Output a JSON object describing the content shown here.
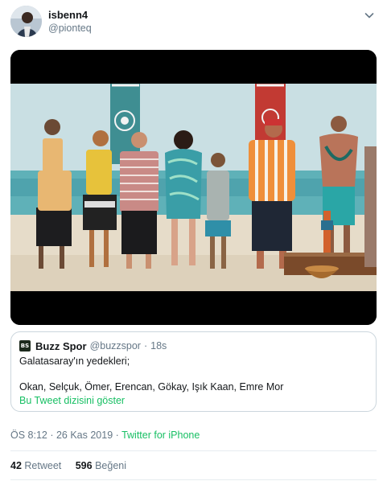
{
  "author": {
    "name": "isbenn4",
    "handle": "@pionteq"
  },
  "media": {
    "icon": "photo"
  },
  "quoted": {
    "avatar_text": "BS",
    "name": "Buzz Spor",
    "handle": "@buzzspor",
    "separator": "·",
    "time": "18s",
    "line1": "Galatasaray'ın yedekleri;",
    "line2": "Okan, Selçuk, Ömer, Erencan, Gökay, Işık Kaan, Emre Mor",
    "link": "Bu Tweet dizisini göster"
  },
  "meta": {
    "time_date": "ÖS 8:12 · 26 Kas 2019",
    "separator": " · ",
    "source": "Twitter for iPhone"
  },
  "stats": {
    "retweets_count": "42",
    "retweets_label": "Retweet",
    "likes_count": "596",
    "likes_label": "Beğeni"
  },
  "colors": {
    "accent_link": "#17bf63",
    "muted": "#657786",
    "border": "#ccd6dd"
  }
}
